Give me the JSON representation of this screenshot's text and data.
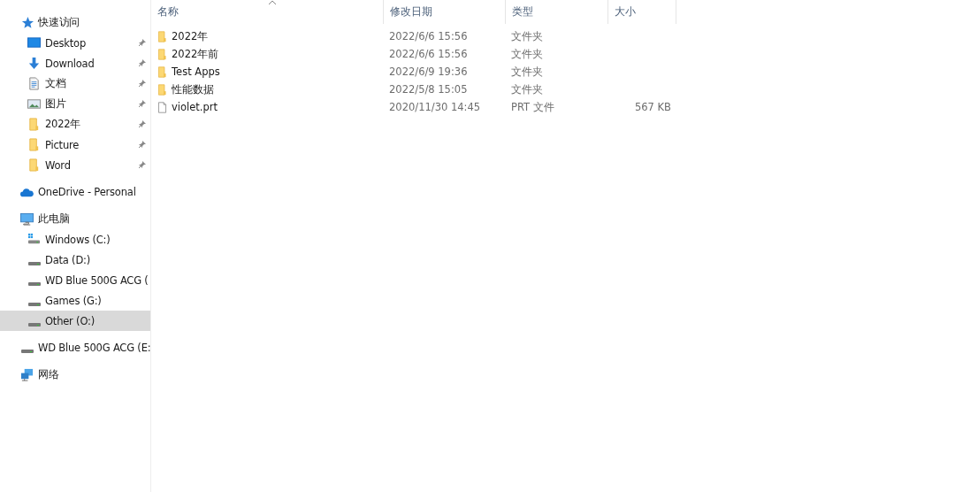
{
  "sidebar": {
    "sections": [
      {
        "label": "快速访问",
        "kind": "star",
        "selected": false,
        "children": [
          {
            "label": "Desktop",
            "kind": "desktop",
            "pinned": true,
            "selected": false
          },
          {
            "label": "Download",
            "kind": "download",
            "pinned": true,
            "selected": false
          },
          {
            "label": "文档",
            "kind": "document",
            "pinned": true,
            "selected": false
          },
          {
            "label": "图片",
            "kind": "image",
            "pinned": true,
            "selected": false
          },
          {
            "label": "2022年",
            "kind": "folder",
            "pinned": true,
            "selected": false
          },
          {
            "label": "Picture",
            "kind": "folder",
            "pinned": true,
            "selected": false
          },
          {
            "label": "Word",
            "kind": "folder",
            "pinned": true,
            "selected": false
          }
        ]
      },
      {
        "label": "OneDrive - Personal",
        "kind": "cloud",
        "selected": false
      },
      {
        "label": "此电脑",
        "kind": "pc",
        "selected": false,
        "children": [
          {
            "label": "Windows (C:)",
            "kind": "system-drive",
            "pinned": false,
            "selected": false
          },
          {
            "label": "Data (D:)",
            "kind": "drive",
            "pinned": false,
            "selected": false
          },
          {
            "label": "WD Blue 500G ACG (",
            "kind": "drive",
            "pinned": false,
            "selected": false
          },
          {
            "label": "Games (G:)",
            "kind": "drive",
            "pinned": false,
            "selected": false
          },
          {
            "label": "Other (O:)",
            "kind": "drive",
            "pinned": false,
            "selected": true
          }
        ]
      },
      {
        "label": "WD Blue 500G ACG (E:",
        "kind": "drive",
        "selected": false
      },
      {
        "label": "网络",
        "kind": "network",
        "selected": false
      }
    ]
  },
  "file_list": {
    "columns": [
      {
        "label": "名称",
        "sorted": true
      },
      {
        "label": "修改日期",
        "sorted": false
      },
      {
        "label": "类型",
        "sorted": false
      },
      {
        "label": "大小",
        "sorted": false
      }
    ],
    "rows": [
      {
        "kind": "folder",
        "name": "2022年",
        "modified": "2022/6/6 15:56",
        "type": "文件夹"
      },
      {
        "kind": "folder",
        "name": "2022年前",
        "modified": "2022/6/6 15:56",
        "type": "文件夹"
      },
      {
        "kind": "folder",
        "name": "Test Apps",
        "modified": "2022/6/9 19:36",
        "type": "文件夹"
      },
      {
        "kind": "folder",
        "name": "性能数据",
        "modified": "2022/5/8 15:05",
        "type": "文件夹"
      },
      {
        "kind": "file",
        "name": "violet.prt",
        "modified": "2020/11/30 14:45",
        "type": "PRT 文件",
        "size": "567 KB"
      }
    ]
  }
}
